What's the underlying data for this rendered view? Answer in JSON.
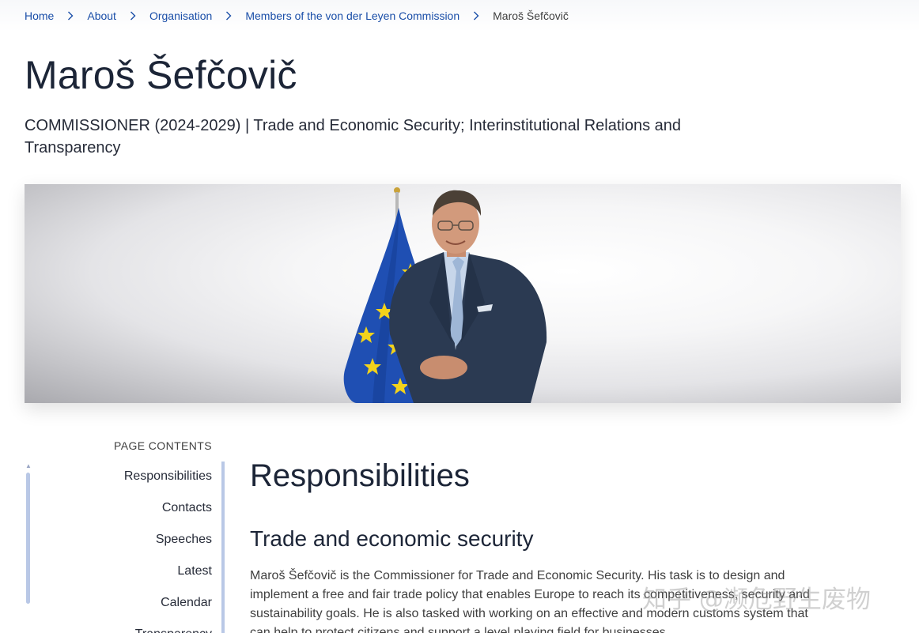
{
  "breadcrumb": {
    "items": [
      {
        "label": "Home"
      },
      {
        "label": "About"
      },
      {
        "label": "Organisation"
      },
      {
        "label": "Members of the von der Leyen Commission"
      }
    ],
    "current": "Maroš Šefčovič"
  },
  "header": {
    "title": "Maroš Šefčovič",
    "subtitle": "COMMISSIONER (2024-2029) | Trade and Economic Security; Interinstitutional Relations and Transparency"
  },
  "hero": {
    "image": "portrait-photo",
    "flag": "eu-flag"
  },
  "sidebar": {
    "heading": "PAGE CONTENTS",
    "items": [
      {
        "label": "Responsibilities"
      },
      {
        "label": "Contacts"
      },
      {
        "label": "Speeches"
      },
      {
        "label": "Latest"
      },
      {
        "label": "Calendar"
      },
      {
        "label": "Transparency"
      }
    ]
  },
  "main": {
    "section_title": "Responsibilities",
    "subsection_title": "Trade and economic security",
    "paragraph": "Maroš Šefčovič is the Commissioner for Trade and Economic Security. His task is to design and implement a free and fair trade policy that enables Europe to reach its competitiveness, security and sustainability goals. He is also tasked with working on an effective and modern customs system that can help to protect citizens and support a level playing field for businesses."
  },
  "watermark": "知乎 @濒危野生废物",
  "colors": {
    "link": "#1a4ea8",
    "rail": "#b9c8e6",
    "heading": "#1c2537",
    "flag_blue": "#1f4fb3",
    "flag_star": "#f2d21b"
  }
}
